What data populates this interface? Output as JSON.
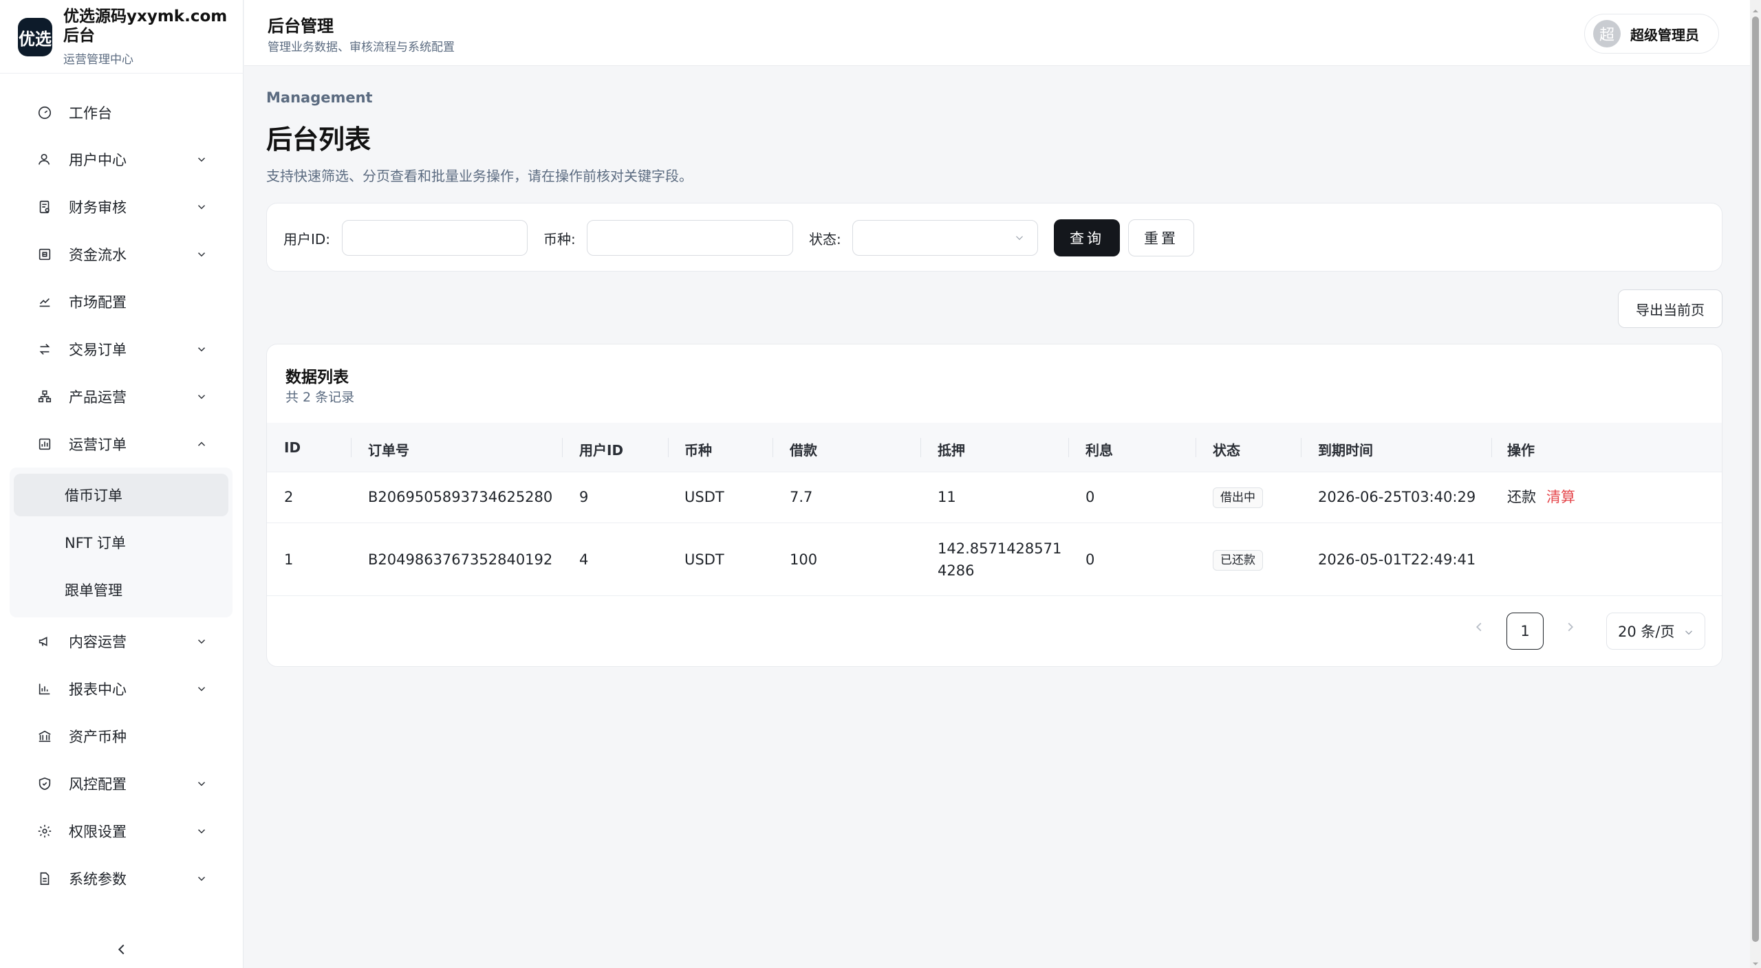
{
  "brand": {
    "logo_text": "优选",
    "name": "优选源码yxymk.com后台",
    "subtitle": "运营管理中心"
  },
  "sidebar": {
    "items": [
      {
        "label": "工作台",
        "icon": "dashboard-icon"
      },
      {
        "label": "用户中心",
        "icon": "user-icon"
      },
      {
        "label": "财务审核",
        "icon": "finance-audit-icon"
      },
      {
        "label": "资金流水",
        "icon": "cashflow-icon"
      },
      {
        "label": "市场配置",
        "icon": "market-chart-icon"
      },
      {
        "label": "交易订单",
        "icon": "swap-icon"
      },
      {
        "label": "产品运营",
        "icon": "org-icon"
      },
      {
        "label": "运营订单",
        "icon": "report-box-icon"
      },
      {
        "label": "内容运营",
        "icon": "megaphone-icon"
      },
      {
        "label": "报表中心",
        "icon": "bar-chart-icon"
      },
      {
        "label": "资产币种",
        "icon": "bank-icon"
      },
      {
        "label": "风控配置",
        "icon": "shield-icon"
      },
      {
        "label": "权限设置",
        "icon": "gear-icon"
      },
      {
        "label": "系统参数",
        "icon": "document-icon"
      }
    ],
    "sub_items": [
      {
        "label": "借币订单",
        "active": true
      },
      {
        "label": "NFT 订单",
        "active": false
      },
      {
        "label": "跟单管理",
        "active": false
      }
    ]
  },
  "header": {
    "title": "后台管理",
    "subtitle": "管理业务数据、审核流程与系统配置",
    "user_avatar": "超",
    "user_name": "超级管理员"
  },
  "page": {
    "eyebrow": "Management",
    "title": "后台列表",
    "description": "支持快速筛选、分页查看和批量业务操作，请在操作前核对关键字段。"
  },
  "filters": {
    "user_id_label": "用户ID:",
    "user_id_value": "",
    "coin_label": "币种:",
    "coin_value": "",
    "status_label": "状态:",
    "status_value": "",
    "query_label": "查询",
    "reset_label": "重置"
  },
  "export_label": "导出当前页",
  "table": {
    "title": "数据列表",
    "count_text": "共 2 条记录",
    "columns": [
      "ID",
      "订单号",
      "用户ID",
      "币种",
      "借款",
      "抵押",
      "利息",
      "状态",
      "到期时间",
      "操作"
    ],
    "rows": [
      {
        "id": "2",
        "order_no": "B2069505893734625280",
        "user_id": "9",
        "coin": "USDT",
        "loan": "7.7",
        "collateral": "11",
        "interest": "0",
        "status": "借出中",
        "due": "2026-06-25T03:40:29",
        "action_repay": "还款",
        "action_liquidate": "清算"
      },
      {
        "id": "1",
        "order_no": "B2049863767352840192",
        "user_id": "4",
        "coin": "USDT",
        "loan": "100",
        "collateral_line1": "142.8571428571",
        "collateral_line2": "4286",
        "interest": "0",
        "status": "已还款",
        "due": "2026-05-01T22:49:41"
      }
    ]
  },
  "pagination": {
    "current_page": "1",
    "page_size": "20 条/页"
  },
  "colors": {
    "primary_dark": "#14171c",
    "danger": "#e5484d",
    "muted": "#5b6b80",
    "background": "#f5f6f8"
  }
}
